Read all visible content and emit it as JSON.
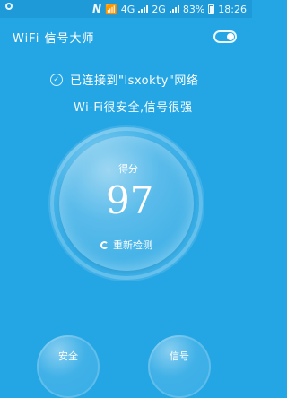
{
  "status_bar": {
    "nfc": "N",
    "battery": "83%",
    "time": "18:26",
    "network_tag_1": "4G",
    "network_tag_2": "2G"
  },
  "header": {
    "title": "WiFi 信号大师"
  },
  "connection": {
    "text": "已连接到\"lsxokty\"网络"
  },
  "security_note": "Wi-Fi很安全,信号很强",
  "score": {
    "label": "得分",
    "value": "97",
    "retest_label": "重新检测"
  },
  "actions": [
    {
      "label": "安全"
    },
    {
      "label": "信号"
    }
  ],
  "colors": {
    "background": "#25a6e4",
    "statusbar": "#1f9ad8",
    "text": "#ffffff"
  },
  "icons": [
    "circle-indicator-icon",
    "check-icon",
    "refresh-icon",
    "toggle-icon",
    "wifi-icon",
    "signal-icon",
    "battery-icon"
  ]
}
